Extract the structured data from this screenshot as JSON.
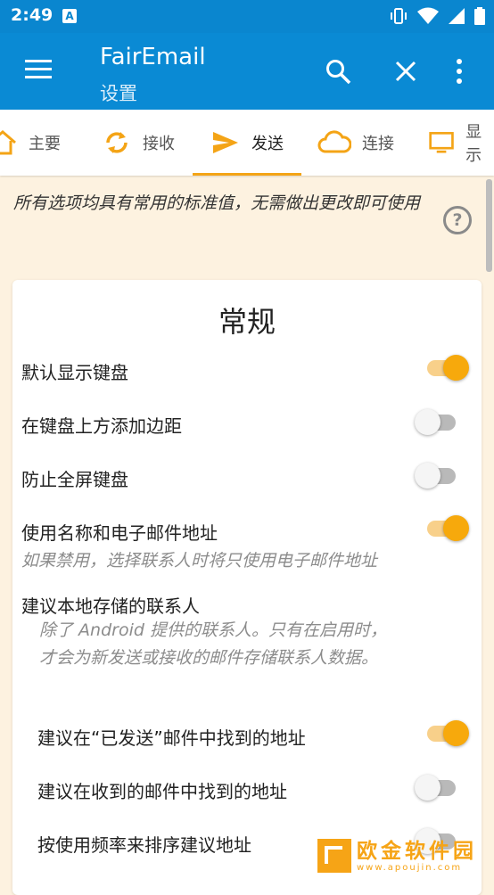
{
  "status_bar": {
    "time": "2:49",
    "notification_icon": "A"
  },
  "app_bar": {
    "title": "FairEmail",
    "subtitle": "设置"
  },
  "tabs": [
    {
      "label": "主要",
      "icon": "home-icon"
    },
    {
      "label": "接收",
      "icon": "sync-icon"
    },
    {
      "label": "发送",
      "icon": "send-icon"
    },
    {
      "label": "连接",
      "icon": "cloud-icon"
    },
    {
      "label": "显示",
      "icon": "monitor-icon"
    }
  ],
  "colors": {
    "primary": "#0a8ad4",
    "accent": "#f7a90c",
    "background": "#fdf2e0"
  },
  "hint": "所有选项均具有常用的标准值，无需做出更改即可使用",
  "card": {
    "title": "常规",
    "rows": [
      {
        "label": "默认显示键盘",
        "on": true
      },
      {
        "label": "在键盘上方添加边距",
        "on": false
      },
      {
        "label": "防止全屏键盘",
        "on": false
      },
      {
        "label": "使用名称和电子邮件地址",
        "on": true,
        "description": "如果禁用，选择联系人时将只使用电子邮件地址"
      },
      {
        "label": "建议本地存储的联系人",
        "description": "除了 Android 提供的联系人。只有在启用时，才会为新发送或接收的邮件存储联系人数据。"
      },
      {
        "label": "建议在“已发送”邮件中找到的地址",
        "on": true
      },
      {
        "label": "建议在收到的邮件中找到的地址",
        "on": false
      },
      {
        "label": "按使用频率来排序建议地址",
        "on": false
      }
    ]
  },
  "watermark": {
    "title": "欧金软件园",
    "url": "www.apoujin.com"
  }
}
